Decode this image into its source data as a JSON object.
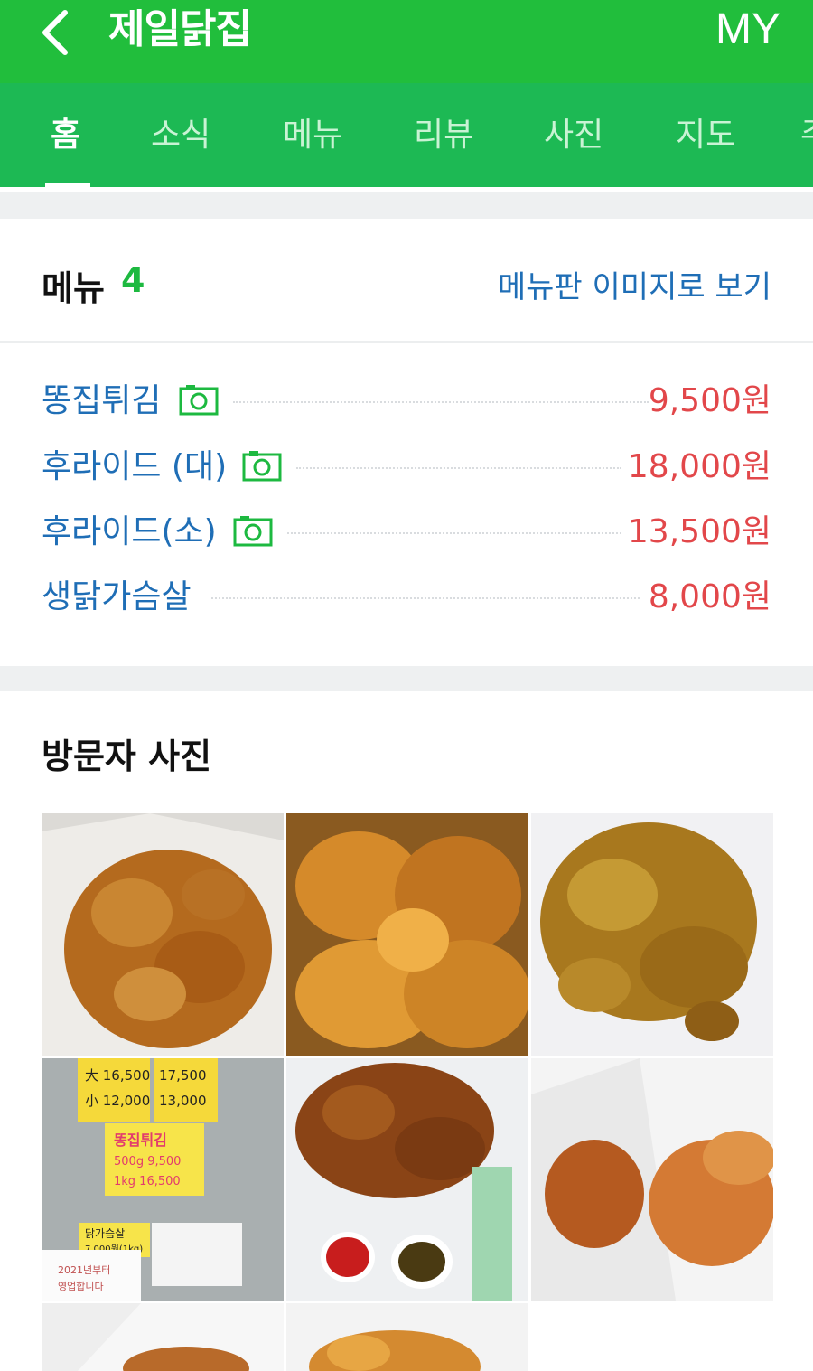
{
  "header": {
    "title": "제일닭집",
    "my_label": "MY"
  },
  "tabs": [
    "홈",
    "소식",
    "메뉴",
    "리뷰",
    "사진",
    "지도",
    "주"
  ],
  "menu_section": {
    "title": "메뉴",
    "count": "4",
    "board_link": "메뉴판 이미지로 보기",
    "items": [
      {
        "name": "똥집튀김",
        "price": "9,500원",
        "has_photo": true
      },
      {
        "name": "후라이드 (대)",
        "price": "18,000원",
        "has_photo": true
      },
      {
        "name": "후라이드(소)",
        "price": "13,500원",
        "has_photo": true
      },
      {
        "name": "생닭가슴살",
        "price": "8,000원",
        "has_photo": false
      }
    ]
  },
  "photos_section": {
    "title": "방문자 사진",
    "photos": [
      {
        "desc": "fried chicken on paper"
      },
      {
        "desc": "fried chicken close-up"
      },
      {
        "desc": "fried gizzard on plate"
      },
      {
        "desc": "handwritten price sign"
      },
      {
        "desc": "fried chicken with sauces"
      },
      {
        "desc": "fried chicken in paper bags"
      },
      {
        "desc": "fried chicken in paper"
      },
      {
        "desc": "fried chicken bowl"
      }
    ],
    "sign_text": {
      "large": "大 16,500",
      "small": "小 12,000",
      "col2a": "17,500",
      "col2b": "13,000",
      "gizzard": "똥집튀김",
      "gizzard_p1": "500g 9,500",
      "gizzard_p2": "1kg 16,500",
      "breast": "닭가슴살",
      "breast_price": "7,000원(1kg)",
      "note": "2021년부터",
      "note2": "영업합니다"
    }
  },
  "colors": {
    "brand_green": "#21be3c",
    "link_blue": "#1f6eb6",
    "price_red": "#e2474a"
  }
}
